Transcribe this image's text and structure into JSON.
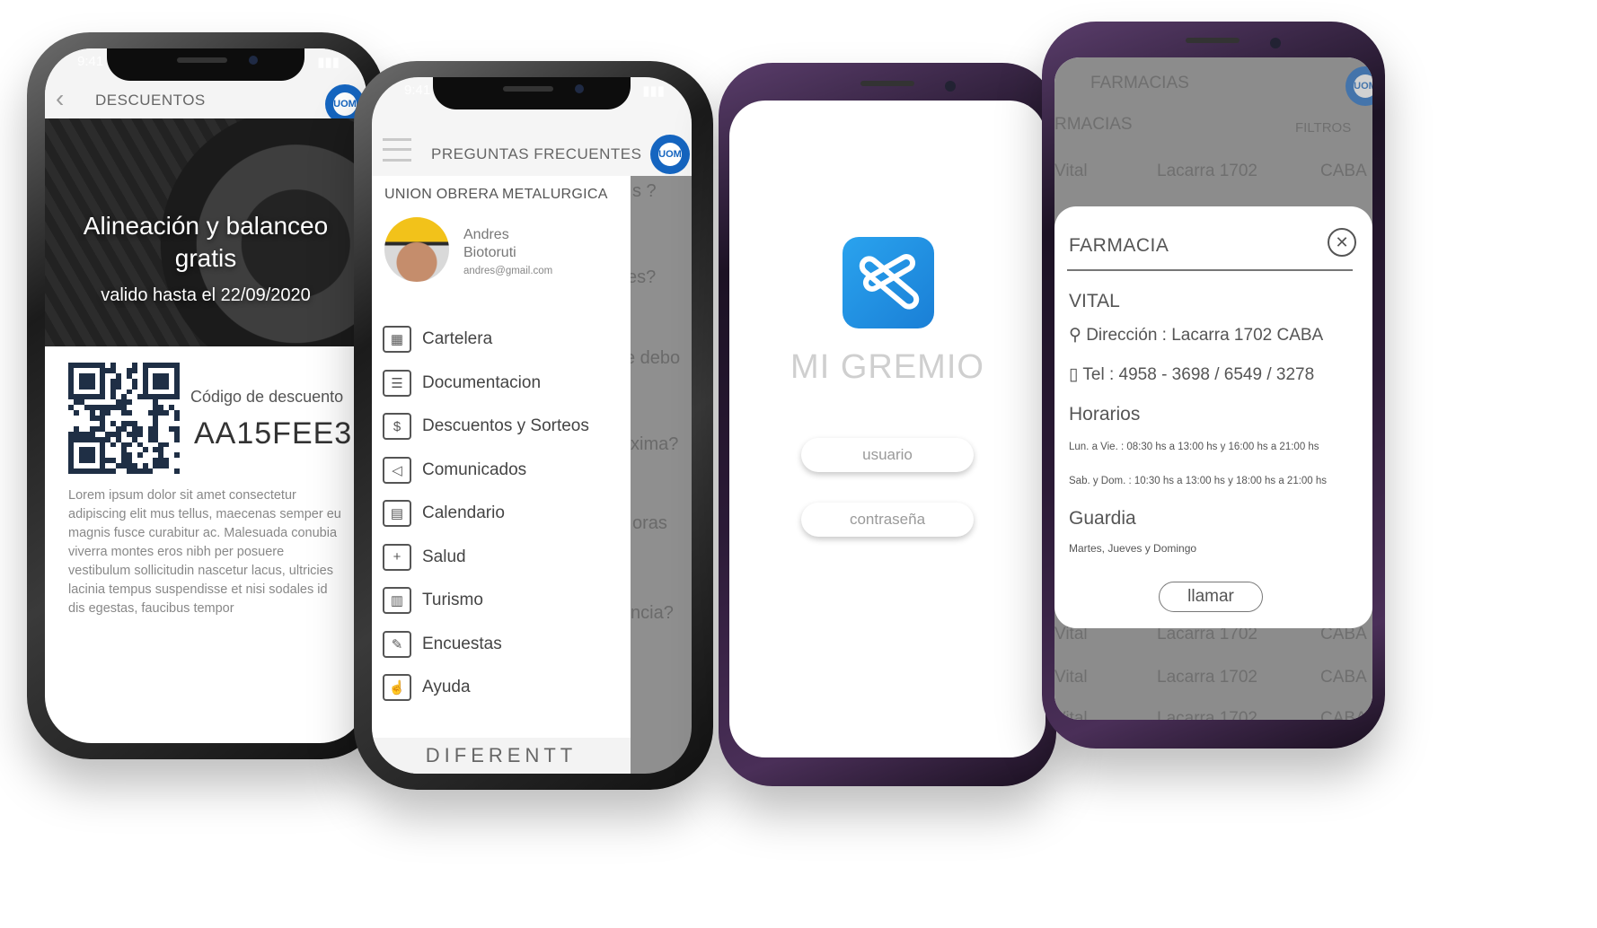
{
  "screen1": {
    "status_time": "9:41",
    "header_title": "DESCUENTOS",
    "banner_title": "Alineación y balanceo gratis",
    "banner_valid": "valido hasta el 22/09/2020",
    "code_label": "Código de descuento",
    "code_value": "AA15FEE3",
    "description": "Lorem ipsum dolor sit amet consectetur adipiscing elit mus tellus, maecenas semper eu magnis fusce curabitur ac. Malesuada conubia viverra montes eros nibh per posuere vestibulum sollicitudin nascetur lacus, ultricies lacinia tempus suspendisse et nisi sodales id dis egestas, faucibus tempor",
    "logo_text": "UOM"
  },
  "screen2": {
    "status_time": "9:41",
    "header_title": "PREGUNTAS FRECUENTES",
    "org_name": "UNION OBRERA METALURGICA",
    "user_first": "Andres",
    "user_last": "Biotoruti",
    "user_email": "andres@gmail.com",
    "menu": [
      {
        "label": "Cartelera",
        "icon": "board-icon",
        "glyph": "▦"
      },
      {
        "label": "Documentacion",
        "icon": "document-icon",
        "glyph": "☰"
      },
      {
        "label": "Descuentos y Sorteos",
        "icon": "discount-hand-icon",
        "glyph": "$"
      },
      {
        "label": "Comunicados",
        "icon": "megaphone-icon",
        "glyph": "◁"
      },
      {
        "label": "Calendario",
        "icon": "calendar-icon",
        "glyph": "▤"
      },
      {
        "label": "Salud",
        "icon": "health-kit-icon",
        "glyph": "+"
      },
      {
        "label": "Turismo",
        "icon": "building-icon",
        "glyph": "▥"
      },
      {
        "label": "Encuestas",
        "icon": "pen-icon",
        "glyph": "✎"
      },
      {
        "label": "Ayuda",
        "icon": "handshake-icon",
        "glyph": "☝"
      }
    ],
    "background_fragments": [
      "s ?",
      "es?",
      "e debo",
      "xima?",
      "oras",
      "ncia?"
    ],
    "footer_brand": "DIFERENTT",
    "logo_text": "UOM"
  },
  "screen3": {
    "app_name": "MI GREMIO",
    "username_placeholder": "usuario",
    "password_placeholder": "contraseña"
  },
  "screen4": {
    "bg_header": "FARMACIAS",
    "bg_subheader": "RMACIAS",
    "bg_filter": "FILTROS",
    "bg_rows": [
      {
        "name": "Vital",
        "street": "Lacarra 1702",
        "city": "CABA"
      },
      {
        "name": "Vital",
        "street": "Lacarra 1702",
        "city": "CABA"
      },
      {
        "name": "Vital",
        "street": "Lacarra 1702",
        "city": "CABA"
      },
      {
        "name": "Vital",
        "street": "Lacarra 1702",
        "city": "CABA"
      }
    ],
    "card_title": "FARMACIA",
    "pharmacy_name": "VITAL",
    "address": "Dirección : Lacarra 1702 CABA",
    "phone": "Tel : 4958 - 3698 / 6549 / 3278",
    "hours_title": "Horarios",
    "hours_weekday": "Lun. a Vie. : 08:30 hs a 13:00 hs y 16:00 hs a 21:00 hs",
    "hours_weekend": "Sab. y Dom. : 10:30 hs a 13:00 hs y 18:00 hs a 21:00 hs",
    "guard_title": "Guardia",
    "guard_days": "Martes, Jueves y Domingo",
    "call_button": "llamar",
    "close_glyph": "✕",
    "logo_text": "UOM"
  }
}
